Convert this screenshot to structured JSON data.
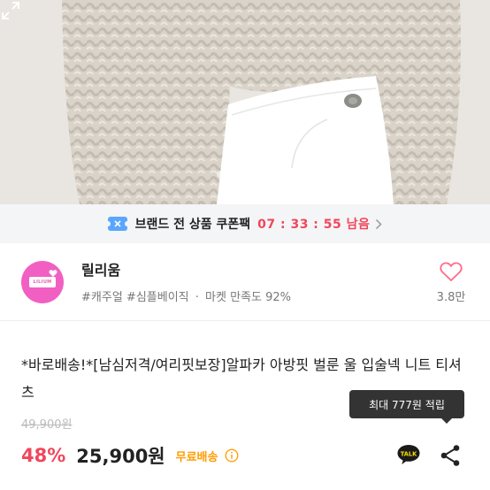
{
  "photo": {
    "alt": "product photo",
    "active_slide": 4,
    "slide_count": 5
  },
  "coupon": {
    "text": "브랜드 전 상품 쿠폰팩",
    "timer": "07 : 33 : 55 남음",
    "icon": "coupon-icon",
    "accent": "#f0475c"
  },
  "brand": {
    "name": "릴리움",
    "logo_text": "LILIUM",
    "tags": [
      "#캐주얼",
      "#심플베이직"
    ],
    "satisfaction": "마켓 만족도 92%",
    "separator": "·",
    "like_count": "3.8만"
  },
  "product": {
    "title": "*바로배송!*[남심저격/여리핏보장]알파카 아방핏 벌룬 울 입술넥 니트 티셔츠",
    "tooltip": "최대 777원 적립",
    "original_price": "49,900원",
    "discount": "48%",
    "price": "25,900원",
    "shipping": "무료배송",
    "talk_label": "TALK"
  },
  "colors": {
    "discount": "#f0475c",
    "shipping": "#ff9c00",
    "brand_logo": "#f25fc2"
  }
}
